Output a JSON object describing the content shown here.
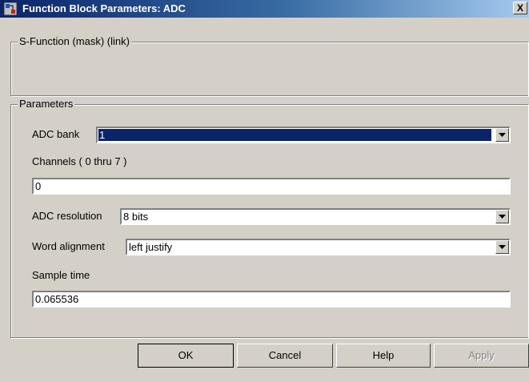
{
  "window": {
    "title": "Function Block Parameters: ADC",
    "close_label": "X"
  },
  "description_group": {
    "legend": "S-Function (mask) (link)"
  },
  "parameters_group": {
    "legend": "Parameters",
    "adc_bank": {
      "label": "ADC bank",
      "value": "1"
    },
    "channels": {
      "label": "Channels ( 0 thru 7 )",
      "value": "0"
    },
    "adc_resolution": {
      "label": "ADC resolution",
      "value": "8 bits"
    },
    "word_alignment": {
      "label": "Word alignment",
      "value": "left justify"
    },
    "sample_time": {
      "label": "Sample time",
      "value": "0.065536"
    }
  },
  "buttons": {
    "ok": "OK",
    "cancel": "Cancel",
    "help": "Help",
    "apply": "Apply"
  },
  "icons": {
    "title_icon": "simulink-block-icon",
    "dropdown": "chevron-down-icon"
  }
}
